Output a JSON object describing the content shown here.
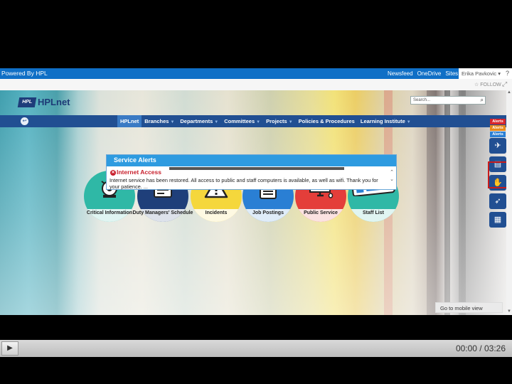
{
  "suitebar": {
    "brand": "Powered By HPL",
    "links": [
      "Newsfeed",
      "OneDrive",
      "Sites"
    ],
    "user": "Erika Pavkovic",
    "help": "?"
  },
  "subbar": {
    "follow": "☆ FOLLOW",
    "focus": "⤢"
  },
  "logo": {
    "mark": "HPL",
    "text": "HPLnet"
  },
  "search": {
    "placeholder": "Search..."
  },
  "nav": {
    "home_icon": "back-arrow-icon",
    "items": [
      {
        "label": "HPLnet",
        "active": true,
        "caret": false
      },
      {
        "label": "Branches",
        "caret": true
      },
      {
        "label": "Departments",
        "caret": true
      },
      {
        "label": "Committees",
        "caret": true
      },
      {
        "label": "Projects",
        "caret": true
      },
      {
        "label": "Policies & Procedures",
        "caret": false
      },
      {
        "label": "Learning Institute",
        "caret": true
      }
    ]
  },
  "tiles": [
    {
      "label": "Critical Information",
      "color": "#2fb8a6",
      "icon": "siren-icon"
    },
    {
      "label": "Duty Managers' Schedule",
      "color": "#1f3f7a",
      "icon": "calendar-icon"
    },
    {
      "label": "Incidents",
      "color": "#f5d73c",
      "icon": "warning-icon"
    },
    {
      "label": "Job Postings",
      "color": "#2a7fd4",
      "icon": "clipboard-icon"
    },
    {
      "label": "Public Service",
      "color": "#e43e3a",
      "icon": "computer-icon"
    },
    {
      "label": "Staff List",
      "color": "#2fb8a6",
      "icon": "id-card-icon"
    }
  ],
  "alerts": {
    "header": "Service Alerts",
    "title": "Internet Access",
    "body": "Internet service has been restored. All access to public and staff computers is available, as well as wifi. Thank you for your patience. ..."
  },
  "badges": [
    {
      "label": "Alerts",
      "color": "#d8262c"
    },
    {
      "label": "Alerts",
      "color": "#e88a1a"
    },
    {
      "label": "Alerts",
      "color": "#2a7fd4"
    }
  ],
  "side_buttons": [
    "bird-icon",
    "newspaper-icon",
    "hand-icon",
    "paper-plane-icon",
    "ticket-icon"
  ],
  "mobile": "Go to mobile view",
  "player": {
    "time": "00:00 / 03:26"
  }
}
